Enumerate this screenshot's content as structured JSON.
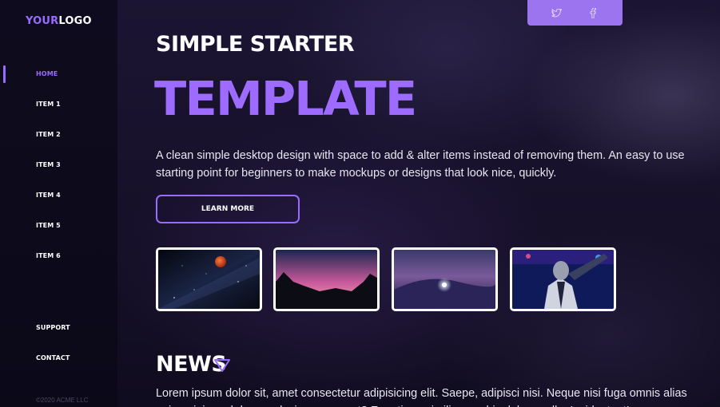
{
  "logo": {
    "accent": "YOUR",
    "rest": "LOGO"
  },
  "nav": {
    "items": [
      "HOME",
      "ITEM 1",
      "ITEM 2",
      "ITEM 3",
      "ITEM 4",
      "ITEM 5",
      "ITEM 6"
    ],
    "active": "HOME",
    "footer_items": [
      "SUPPORT",
      "CONTACT"
    ],
    "copyright": "©2020 ACME LLC"
  },
  "social": [
    "twitter-icon",
    "facebook-icon"
  ],
  "hero": {
    "subtitle": "SIMPLE STARTER",
    "title": "TEMPLATE",
    "description": "A clean simple desktop design with space to add & alter items instead of removing them. An easy to use starting point for beginners to make mockups or designs that look nice, quickly.",
    "button_label": "LEARN MORE"
  },
  "gallery": [
    "space-galaxy-thumbnail",
    "mountain-sunset-thumbnail",
    "snow-night-thumbnail",
    "neon-portrait-thumbnail"
  ],
  "news": {
    "title": "NEWS",
    "body": "Lorem ipsum dolor sit, amet consectetur adipisicing elit. Saepe, adipisci nisi. Neque nisi fuga omnis alias enim minima ab harum ducimus quaerat? Ex ratione similique nobis dolore nulla. Incidunt, et!"
  },
  "colors": {
    "accent": "#9a6bff",
    "social_bar": "#9d74f0",
    "background": "#130f24"
  }
}
